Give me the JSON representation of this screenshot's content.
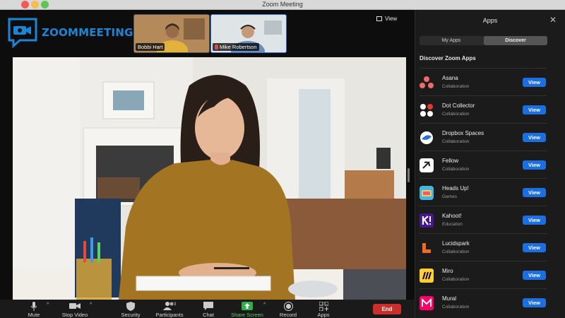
{
  "window": {
    "title": "Zoom Meeting"
  },
  "logo": {
    "text": "ZOOMMEETING"
  },
  "participants_strip": [
    {
      "name": "Bobbi Hart",
      "muted": false
    },
    {
      "name": "Mike Robertson",
      "muted": true
    }
  ],
  "view_button": "View",
  "toolbar": {
    "mute": "Mute",
    "stop_video": "Stop Video",
    "security": "Security",
    "participants": "Participants",
    "participants_count": "3",
    "chat": "Chat",
    "share_screen": "Share Screen",
    "record": "Record",
    "apps": "Apps",
    "end": "End"
  },
  "apps_panel": {
    "title": "Apps",
    "tabs": {
      "my_apps": "My Apps",
      "discover": "Discover"
    },
    "section_title": "Discover Zoom Apps",
    "view_label": "View",
    "apps": [
      {
        "name": "Asana",
        "category": "Collaboration",
        "icon": "asana-icon"
      },
      {
        "name": "Dot Collector",
        "category": "Collaboration",
        "icon": "dot-collector-icon"
      },
      {
        "name": "Dropbox Spaces",
        "category": "Collaboration",
        "icon": "dropbox-spaces-icon"
      },
      {
        "name": "Fellow",
        "category": "Collaboration",
        "icon": "fellow-icon"
      },
      {
        "name": "Heads Up!",
        "category": "Games",
        "icon": "heads-up-icon"
      },
      {
        "name": "Kahoot!",
        "category": "Education",
        "icon": "kahoot-icon"
      },
      {
        "name": "Lucidspark",
        "category": "Collaboration",
        "icon": "lucidspark-icon"
      },
      {
        "name": "Miro",
        "category": "Collaboration",
        "icon": "miro-icon"
      },
      {
        "name": "Mural",
        "category": "Collaboration",
        "icon": "mural-icon"
      }
    ]
  },
  "colors": {
    "accent": "#1b6fe0",
    "end": "#cc2f2b",
    "share": "#5ec86a",
    "logo": "#1c86d6"
  }
}
